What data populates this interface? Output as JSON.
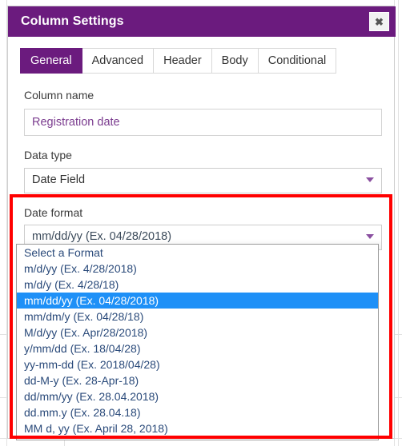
{
  "dialog": {
    "title": "Column Settings",
    "close_icon": "close-icon",
    "close_glyph": "✖"
  },
  "tabs": [
    {
      "label": "General",
      "active": true
    },
    {
      "label": "Advanced",
      "active": false
    },
    {
      "label": "Header",
      "active": false
    },
    {
      "label": "Body",
      "active": false
    },
    {
      "label": "Conditional",
      "active": false
    }
  ],
  "fields": {
    "column_name": {
      "label": "Column name",
      "value": "Registration date"
    },
    "data_type": {
      "label": "Data type",
      "value": "Date Field",
      "arrow_icon": "chevron-down-icon"
    },
    "date_format": {
      "label": "Date format",
      "value": "mm/dd/yy (Ex. 04/28/2018)",
      "arrow_icon": "chevron-down-icon",
      "expanded": true,
      "options": [
        "Select a Format",
        "m/d/yy (Ex. 4/28/2018)",
        "m/d/y (Ex. 4/28/18)",
        "mm/dd/yy (Ex. 04/28/2018)",
        "mm/dm/y (Ex. 04/28/18)",
        "M/d/yy (Ex. Apr/28/2018)",
        "y/mm/dd (Ex. 18/04/28)",
        "yy-mm-dd (Ex. 2018/04/28)",
        "dd-M-y (Ex. 28-Apr-18)",
        "dd/mm/yy (Ex. 28.04.2018)",
        "dd.mm.y (Ex. 28.04.18)",
        "MM d, yy (Ex. April 28, 2018)"
      ],
      "selected_index": 3
    }
  },
  "annotation": {
    "highlight_color": "#FF0000"
  },
  "colors": {
    "brand_purple": "#6B1B7E",
    "selection_blue": "#1E90F7",
    "input_text_purple": "#7B3C8F",
    "option_text_blue": "#2A4A7A"
  }
}
